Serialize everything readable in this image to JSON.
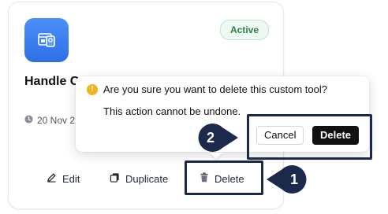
{
  "card": {
    "status": "Active",
    "tool_name": "Handle C",
    "date": "20 Nov 2",
    "actions": {
      "edit": "Edit",
      "duplicate": "Duplicate",
      "delete": "Delete"
    }
  },
  "popconfirm": {
    "title": "Are you sure you want to delete this custom tool?",
    "description": "This action cannot be undone.",
    "cancel_label": "Cancel",
    "confirm_label": "Delete",
    "warning_glyph": "!"
  },
  "steps": {
    "first": "1",
    "second": "2"
  },
  "colors": {
    "accent_blue": "#3b82f6",
    "status_green": "#2e7d45",
    "warning_yellow": "#f5b21a",
    "marker_navy": "#1b2a4a"
  }
}
